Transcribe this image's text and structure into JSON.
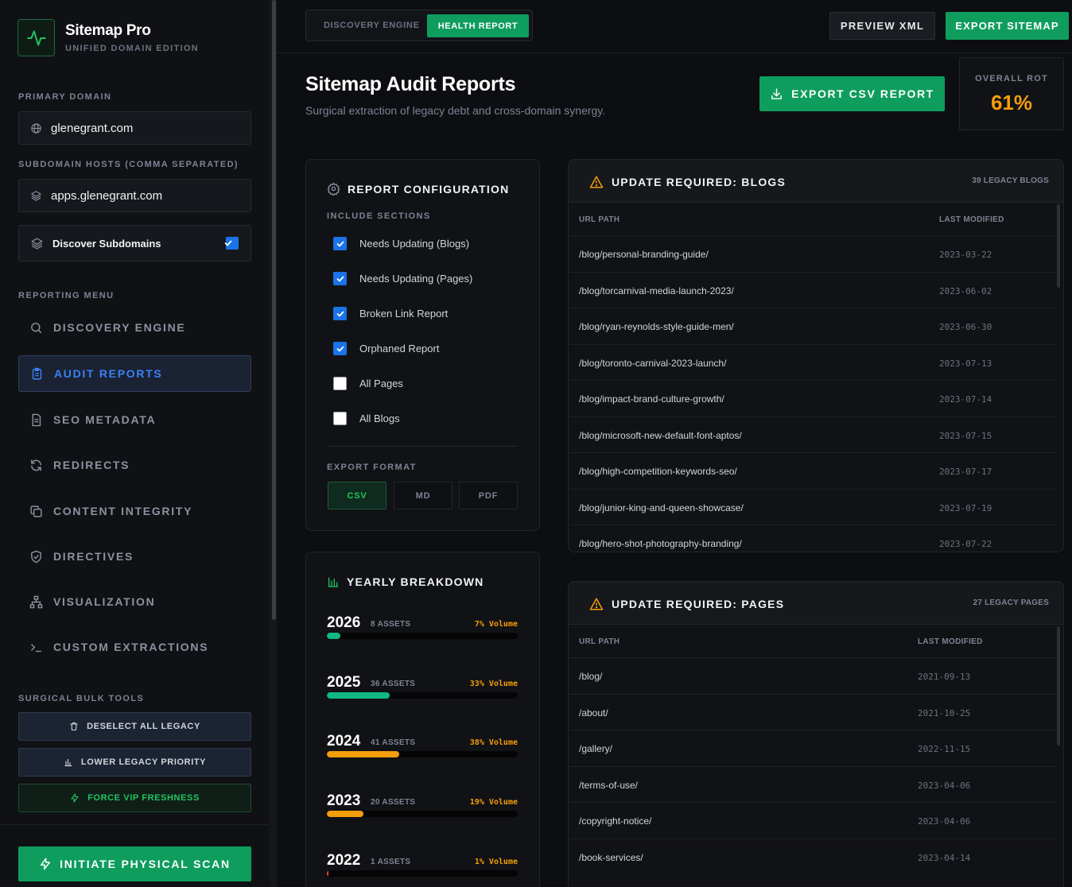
{
  "brand": {
    "title": "Sitemap Pro",
    "subtitle": "UNIFIED DOMAIN EDITION"
  },
  "sidebar": {
    "primary_domain_label": "PRIMARY DOMAIN",
    "primary_domain_value": "glenegrant.com",
    "subdomain_label": "SUBDOMAIN HOSTS (COMMA SEPARATED)",
    "subdomain_value": "apps.glenegrant.com",
    "discover_label": "Discover Subdomains",
    "discover_checked": true,
    "menu_label": "REPORTING MENU",
    "menu": [
      {
        "label": "DISCOVERY ENGINE",
        "icon": "search-icon"
      },
      {
        "label": "AUDIT REPORTS",
        "icon": "clipboard-icon",
        "active": true
      },
      {
        "label": "SEO METADATA",
        "icon": "document-icon"
      },
      {
        "label": "REDIRECTS",
        "icon": "refresh-icon"
      },
      {
        "label": "CONTENT INTEGRITY",
        "icon": "copy-icon"
      },
      {
        "label": "DIRECTIVES",
        "icon": "shield-check-icon"
      },
      {
        "label": "VISUALIZATION",
        "icon": "sitemap-tree-icon"
      },
      {
        "label": "CUSTOM EXTRACTIONS",
        "icon": "terminal-icon"
      }
    ],
    "bulk_label": "SURGICAL BULK TOOLS",
    "bulk_tools": [
      {
        "label": "DESELECT ALL LEGACY",
        "icon": "trash-icon"
      },
      {
        "label": "LOWER LEGACY PRIORITY",
        "icon": "bar-chart-icon"
      },
      {
        "label": "FORCE VIP FRESHNESS",
        "icon": "lightning-icon"
      }
    ],
    "scan_button": "INITIATE PHYSICAL SCAN"
  },
  "topbar": {
    "tab_discovery": "DISCOVERY ENGINE",
    "tab_health": "HEALTH REPORT",
    "preview_button": "PREVIEW XML",
    "export_button": "EXPORT SITEMAP"
  },
  "header": {
    "title": "Sitemap Audit Reports",
    "subtitle": "Surgical extraction of legacy debt and cross-domain synergy.",
    "export_csv_button": "EXPORT CSV REPORT",
    "rot_label": "OVERALL ROT",
    "rot_value": "61%"
  },
  "config": {
    "title": "REPORT CONFIGURATION",
    "include_label": "INCLUDE SECTIONS",
    "sections": [
      {
        "label": "Needs Updating (Blogs)",
        "checked": true
      },
      {
        "label": "Needs Updating (Pages)",
        "checked": true
      },
      {
        "label": "Broken Link Report",
        "checked": true
      },
      {
        "label": "Orphaned Report",
        "checked": true
      },
      {
        "label": "All Pages",
        "checked": false
      },
      {
        "label": "All Blogs",
        "checked": false
      }
    ],
    "format_label": "EXPORT FORMAT",
    "formats": [
      "CSV",
      "MD",
      "PDF"
    ],
    "selected_format": "CSV"
  },
  "breakdown": {
    "title": "YEARLY BREAKDOWN",
    "years": [
      {
        "year": "2026",
        "assets": "8 ASSETS",
        "volume": "7% Volume",
        "fraction": 0.07,
        "color": "#10b981"
      },
      {
        "year": "2025",
        "assets": "36 ASSETS",
        "volume": "33% Volume",
        "fraction": 0.33,
        "color": "#10b981"
      },
      {
        "year": "2024",
        "assets": "41 ASSETS",
        "volume": "38% Volume",
        "fraction": 0.38,
        "color": "#f59e0b"
      },
      {
        "year": "2023",
        "assets": "20 ASSETS",
        "volume": "19% Volume",
        "fraction": 0.19,
        "color": "#f59e0b"
      },
      {
        "year": "2022",
        "assets": "1 ASSETS",
        "volume": "1% Volume",
        "fraction": 0.01,
        "color": "#ef4444"
      }
    ]
  },
  "blogs": {
    "title": "UPDATE REQUIRED: BLOGS",
    "count": "39 LEGACY BLOGS",
    "col_path": "URL PATH",
    "col_modified": "LAST MODIFIED",
    "rows": [
      {
        "path": "/blog/personal-branding-guide/",
        "date": "2023-03-22"
      },
      {
        "path": "/blog/torcarnival-media-launch-2023/",
        "date": "2023-06-02"
      },
      {
        "path": "/blog/ryan-reynolds-style-guide-men/",
        "date": "2023-06-30"
      },
      {
        "path": "/blog/toronto-carnival-2023-launch/",
        "date": "2023-07-13"
      },
      {
        "path": "/blog/impact-brand-culture-growth/",
        "date": "2023-07-14"
      },
      {
        "path": "/blog/microsoft-new-default-font-aptos/",
        "date": "2023-07-15"
      },
      {
        "path": "/blog/high-competition-keywords-seo/",
        "date": "2023-07-17"
      },
      {
        "path": "/blog/junior-king-and-queen-showcase/",
        "date": "2023-07-19"
      },
      {
        "path": "/blog/hero-shot-photography-branding/",
        "date": "2023-07-22"
      }
    ]
  },
  "pages": {
    "title": "UPDATE REQUIRED: PAGES",
    "count": "27 LEGACY PAGES",
    "col_path": "URL PATH",
    "col_modified": "LAST MODIFIED",
    "rows": [
      {
        "path": "/blog/",
        "date": "2021-09-13"
      },
      {
        "path": "/about/",
        "date": "2021-10-25"
      },
      {
        "path": "/gallery/",
        "date": "2022-11-15"
      },
      {
        "path": "/terms-of-use/",
        "date": "2023-04-06"
      },
      {
        "path": "/copyright-notice/",
        "date": "2023-04-06"
      },
      {
        "path": "/book-services/",
        "date": "2023-04-14"
      }
    ]
  }
}
